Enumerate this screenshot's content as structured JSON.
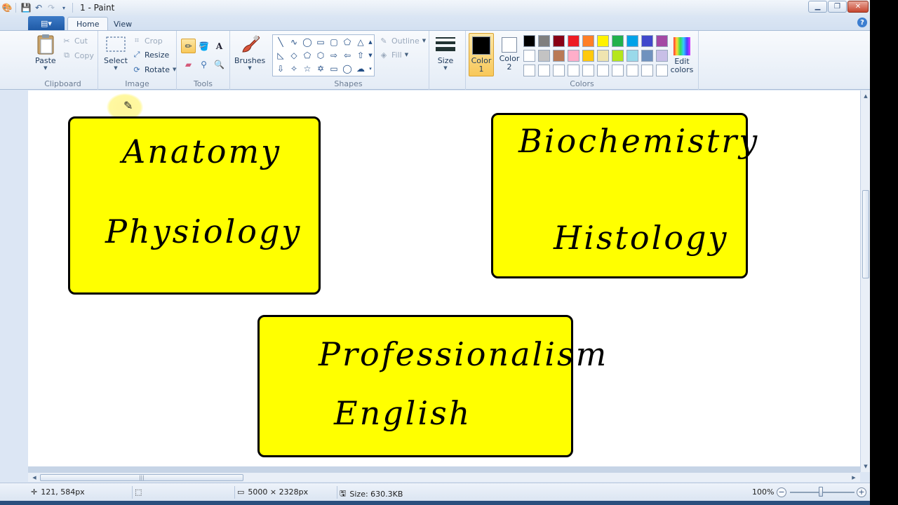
{
  "window": {
    "title": "1 - Paint"
  },
  "tabs": {
    "file_icon": "▤▾",
    "home": "Home",
    "view": "View"
  },
  "clipboard": {
    "paste": "Paste",
    "cut": "Cut",
    "copy": "Copy",
    "label": "Clipboard"
  },
  "image": {
    "select": "Select",
    "crop": "Crop",
    "resize": "Resize",
    "rotate": "Rotate",
    "label": "Image"
  },
  "tools": {
    "label": "Tools"
  },
  "brushes": {
    "label": "Brushes"
  },
  "shapes": {
    "outline": "Outline",
    "fill": "Fill",
    "label": "Shapes"
  },
  "size": {
    "label": "Size"
  },
  "colors": {
    "color1_line1": "Color",
    "color1_line2": "1",
    "color2_line1": "Color",
    "color2_line2": "2",
    "edit_line1": "Edit",
    "edit_line2": "colors",
    "label": "Colors",
    "color1": "#000000",
    "color2": "#ffffff",
    "palette": [
      "#000000",
      "#7f7f7f",
      "#880015",
      "#ed1c24",
      "#ff7f27",
      "#fff200",
      "#22b14c",
      "#00a2e8",
      "#3f48cc",
      "#a349a4",
      "#ffffff",
      "#c3c3c3",
      "#b97a57",
      "#ffaec9",
      "#ffc90e",
      "#efe4b0",
      "#b5e61d",
      "#99d9ea",
      "#7092be",
      "#c8bfe7",
      "#ffffff",
      "#ffffff",
      "#ffffff",
      "#ffffff",
      "#ffffff",
      "#ffffff",
      "#ffffff",
      "#ffffff",
      "#ffffff",
      "#ffffff"
    ]
  },
  "canvas": {
    "card1": {
      "line1": "Anatomy",
      "line2": "Physiology"
    },
    "card2": {
      "line1": "Biochemistry",
      "line2": "Histology"
    },
    "card3": {
      "line1": "Professionalism",
      "line2": "English"
    }
  },
  "status": {
    "cursor_pos": "121, 584px",
    "dimensions": "5000 × 2328px",
    "file_size": "Size: 630.3KB",
    "zoom": "100%"
  }
}
